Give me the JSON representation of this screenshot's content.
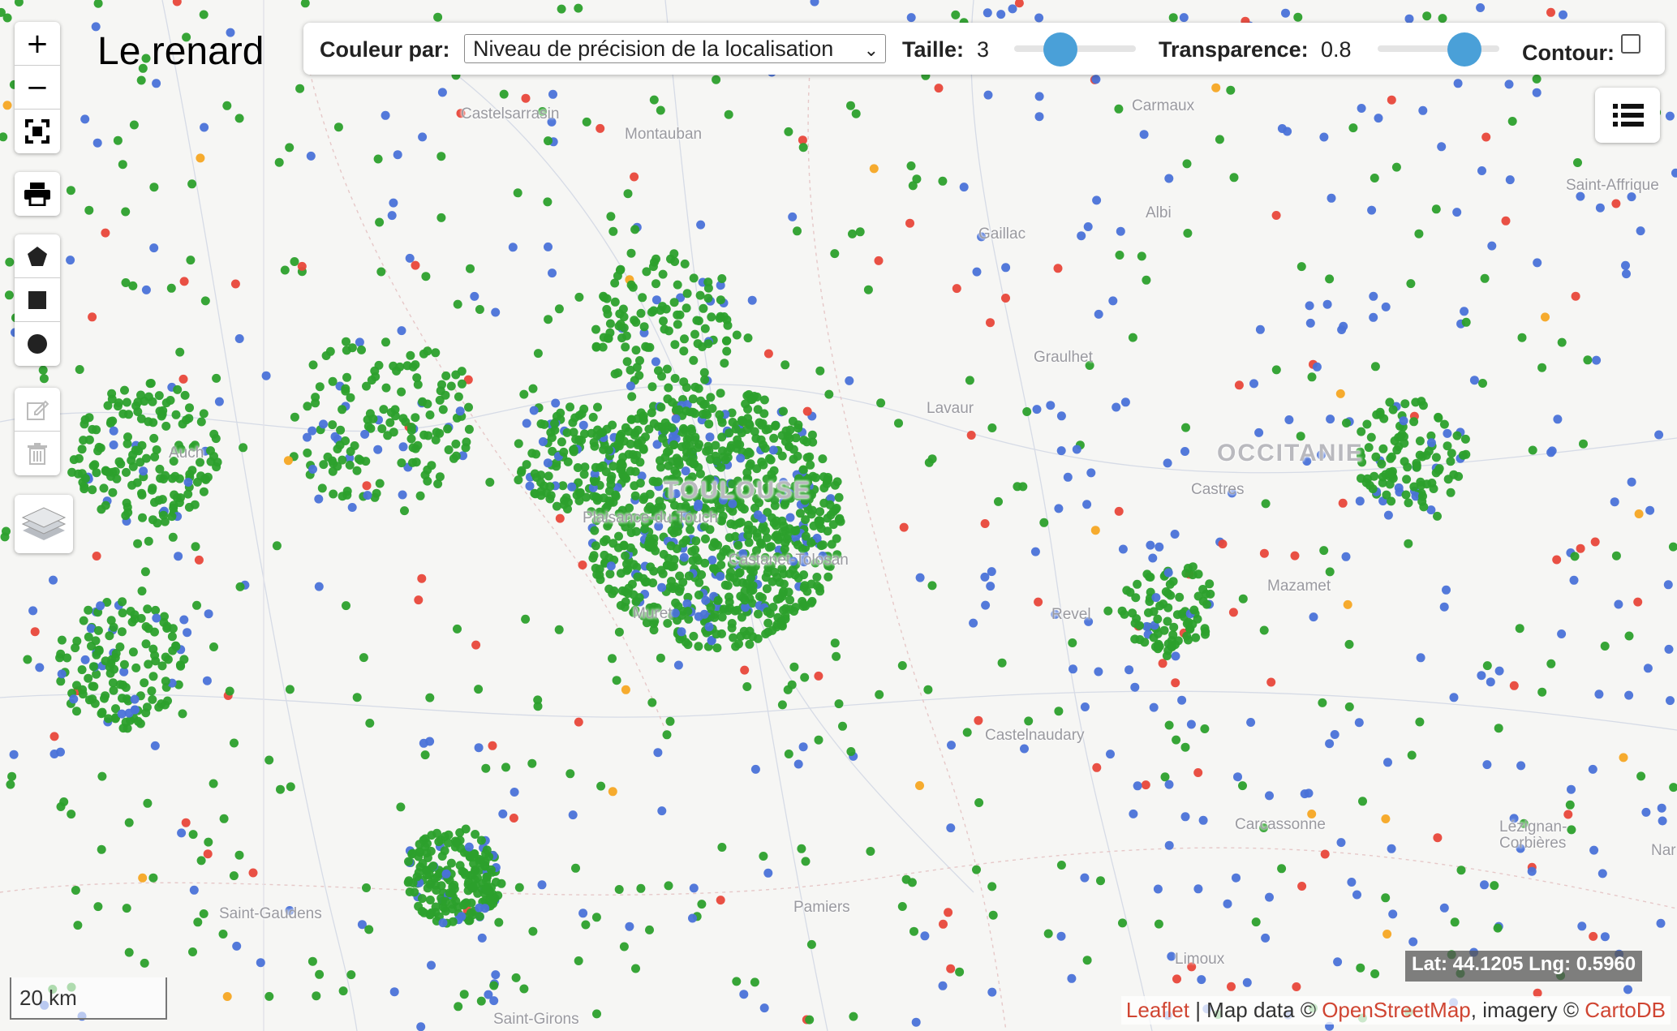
{
  "title": "Le renard",
  "controls": {
    "zoom_in": "+",
    "zoom_out": "−",
    "fullscreen_icon": "fullscreen-icon",
    "print_icon": "print-icon",
    "draw_polygon_icon": "polygon-icon",
    "draw_rectangle_icon": "rectangle-icon",
    "draw_circle_icon": "circle-icon",
    "edit_icon": "edit-icon",
    "delete_icon": "trash-icon",
    "layers_icon": "layers-icon",
    "legend_icon": "list-icon"
  },
  "toolbar": {
    "color_label": "Couleur par:",
    "color_value": "Niveau de précision de la localisation",
    "size_label": "Taille:",
    "size_value": "3",
    "size_level": 0.33,
    "opacity_label": "Transparence:",
    "opacity_value": "0.8",
    "opacity_level": 0.8,
    "contour_label": "Contour:",
    "contour_checked": false
  },
  "places": [
    "Castelsarrasin",
    "Montauban",
    "Carmaux",
    "Saint-Affrique",
    "Albi",
    "Gaillac",
    "Graulhet",
    "Lavaur",
    "Auch",
    "TOULOUSE",
    "OCCITANIE",
    "Castres",
    "Plaisance-du-Touch",
    "Castanet-Tolosan",
    "Muret",
    "Mazamet",
    "Revel",
    "Castelnaudary",
    "Carcassonne",
    "Lézignan-Corbières",
    "Saint-Gaudens",
    "Pamiers",
    "Limoux",
    "Saint-Girons",
    "Nar"
  ],
  "scale": "20 km",
  "coordinates": "Lat: 44.1205 Lng: 0.5960",
  "attribution": {
    "leaflet": "Leaflet",
    "sep1": " | Map data © ",
    "osm": "OpenStreetMap",
    "sep2": ", imagery © ",
    "carto": "CartoDB"
  },
  "colors": {
    "green": "#2ca02c",
    "blue": "#4a72d8",
    "red": "#e8473a",
    "orange": "#f5a623",
    "slider": "#4aa0d8",
    "link": "#d04532"
  }
}
